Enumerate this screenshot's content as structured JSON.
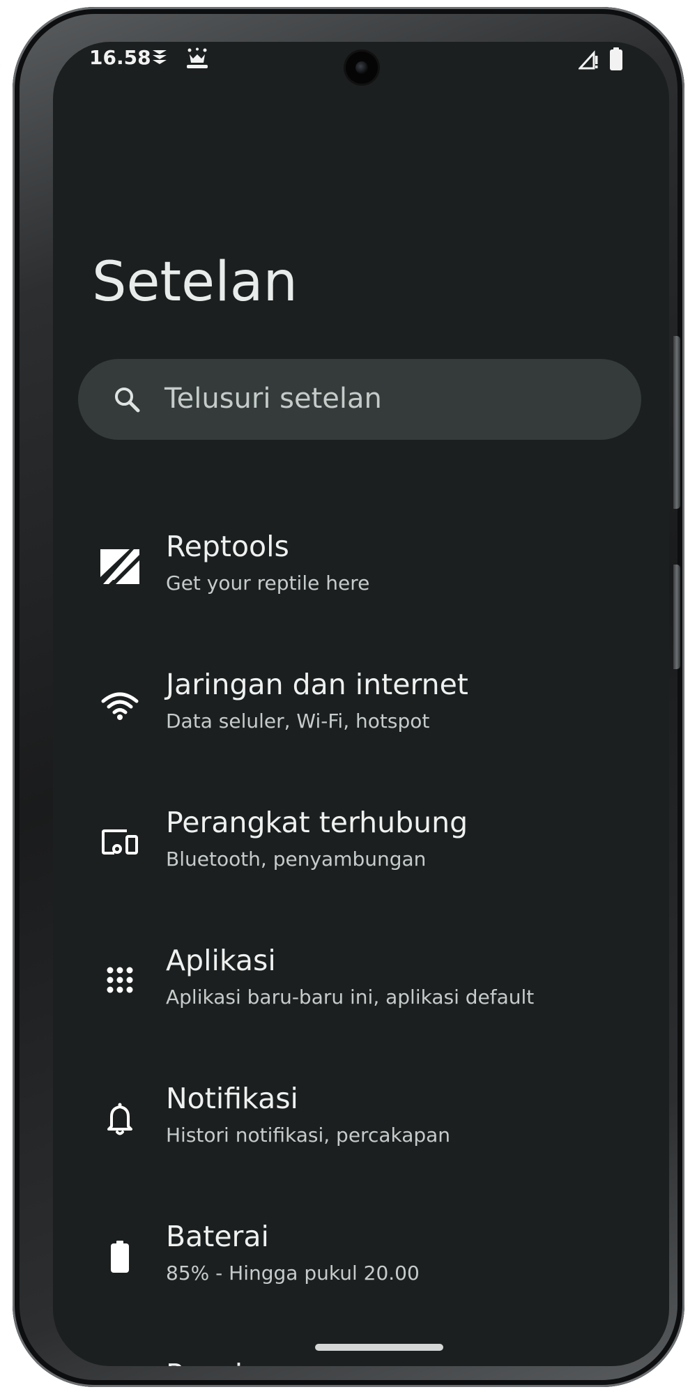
{
  "status_bar": {
    "time": "16.58",
    "icons": [
      "shield-notification-icon",
      "cat-notification-icon",
      "camera-icon",
      "signal-no-data-icon",
      "battery-icon"
    ]
  },
  "header": {
    "title": "Setelan"
  },
  "search": {
    "placeholder": "Telusuri setelan",
    "icon": "search-icon"
  },
  "settings": {
    "items": [
      {
        "title": "Reptools",
        "subtitle": "Get your reptile here",
        "icon": "reptools-logo-icon"
      },
      {
        "title": "Jaringan dan internet",
        "subtitle": "Data seluler, Wi-Fi, hotspot",
        "icon": "wifi-icon"
      },
      {
        "title": "Perangkat terhubung",
        "subtitle": "Bluetooth, penyambungan",
        "icon": "connected-devices-icon"
      },
      {
        "title": "Aplikasi",
        "subtitle": "Aplikasi baru-baru ini, aplikasi default",
        "icon": "apps-grid-icon"
      },
      {
        "title": "Notifikasi",
        "subtitle": "Histori notifikasi, percakapan",
        "icon": "bell-icon"
      },
      {
        "title": "Baterai",
        "subtitle": "85% - Hingga pukul 20.00",
        "icon": "battery-icon"
      },
      {
        "title": "Penyimpanan",
        "subtitle": "",
        "icon": "storage-icon"
      }
    ]
  },
  "colors": {
    "background": "#1c1f1f",
    "search_background": "#343b3a",
    "text_primary": "#eef1f0",
    "text_secondary": "#c6cccb"
  }
}
